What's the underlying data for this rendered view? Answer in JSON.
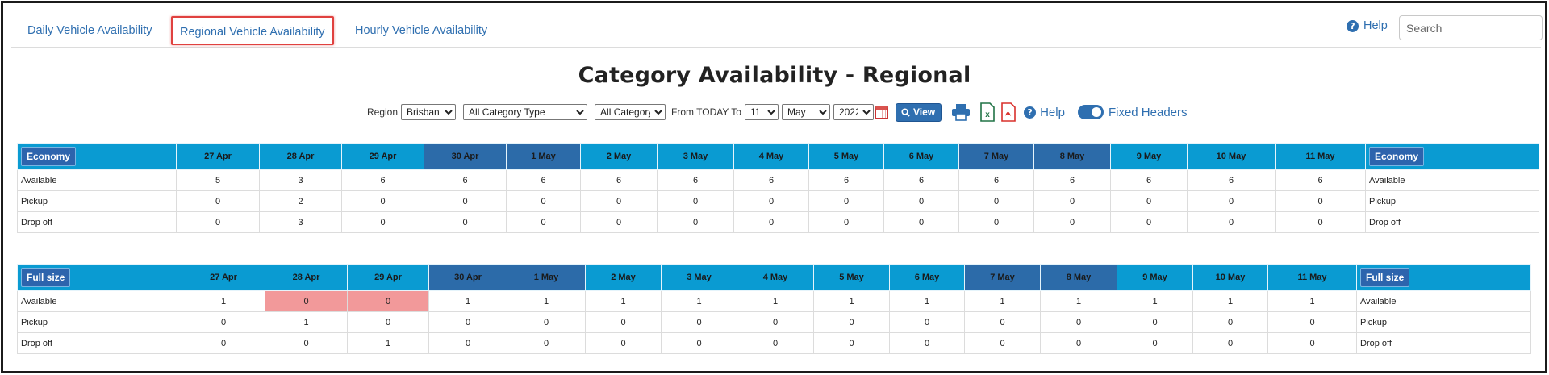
{
  "tabs": [
    {
      "label": "Daily Vehicle Availability"
    },
    {
      "label": "Regional Vehicle Availability"
    },
    {
      "label": "Hourly Vehicle Availability"
    }
  ],
  "header": {
    "help_label": "Help",
    "search_placeholder": "Search"
  },
  "title": "Category Availability - Regional",
  "toolbar": {
    "region_label": "Region",
    "region_value": "Brisbane",
    "category_type_value": "All Category Type",
    "category_value": "All Category",
    "from_label": "From TODAY To",
    "day_value": "11",
    "month_value": "May",
    "year_value": "2022",
    "view_label": "View",
    "help_label": "Help",
    "fixed_headers_label": "Fixed Headers",
    "fixed_headers_on": true
  },
  "tables": [
    {
      "category": "Economy",
      "dates": [
        "27 Apr",
        "28 Apr",
        "29 Apr",
        "30 Apr",
        "1 May",
        "2 May",
        "3 May",
        "4 May",
        "5 May",
        "6 May",
        "7 May",
        "8 May",
        "9 May",
        "10 May",
        "11 May"
      ],
      "weekend": [
        false,
        false,
        false,
        true,
        true,
        false,
        false,
        false,
        false,
        false,
        true,
        true,
        false,
        false,
        false
      ],
      "rows": [
        {
          "label": "Available",
          "values": [
            "5",
            "3",
            "6",
            "6",
            "6",
            "6",
            "6",
            "6",
            "6",
            "6",
            "6",
            "6",
            "6",
            "6",
            "6"
          ],
          "red": []
        },
        {
          "label": "Pickup",
          "values": [
            "0",
            "2",
            "0",
            "0",
            "0",
            "0",
            "0",
            "0",
            "0",
            "0",
            "0",
            "0",
            "0",
            "0",
            "0"
          ],
          "red": []
        },
        {
          "label": "Drop off",
          "values": [
            "0",
            "3",
            "0",
            "0",
            "0",
            "0",
            "0",
            "0",
            "0",
            "0",
            "0",
            "0",
            "0",
            "0",
            "0"
          ],
          "red": []
        }
      ]
    },
    {
      "category": "Full size",
      "dates": [
        "27 Apr",
        "28 Apr",
        "29 Apr",
        "30 Apr",
        "1 May",
        "2 May",
        "3 May",
        "4 May",
        "5 May",
        "6 May",
        "7 May",
        "8 May",
        "9 May",
        "10 May",
        "11 May"
      ],
      "weekend": [
        false,
        false,
        false,
        true,
        true,
        false,
        false,
        false,
        false,
        false,
        true,
        true,
        false,
        false,
        false
      ],
      "rows": [
        {
          "label": "Available",
          "values": [
            "1",
            "0",
            "0",
            "1",
            "1",
            "1",
            "1",
            "1",
            "1",
            "1",
            "1",
            "1",
            "1",
            "1",
            "1"
          ],
          "red": [
            1,
            2
          ]
        },
        {
          "label": "Pickup",
          "values": [
            "0",
            "1",
            "0",
            "0",
            "0",
            "0",
            "0",
            "0",
            "0",
            "0",
            "0",
            "0",
            "0",
            "0",
            "0"
          ],
          "red": []
        },
        {
          "label": "Drop off",
          "values": [
            "0",
            "0",
            "1",
            "0",
            "0",
            "0",
            "0",
            "0",
            "0",
            "0",
            "0",
            "0",
            "0",
            "0",
            "0"
          ],
          "red": []
        }
      ]
    }
  ],
  "colors": {
    "header_blue": "#0a9bd2",
    "weekend_header": "#2c6ba9",
    "shortage_red": "#f2999a",
    "link_blue": "#2f6fb0"
  }
}
